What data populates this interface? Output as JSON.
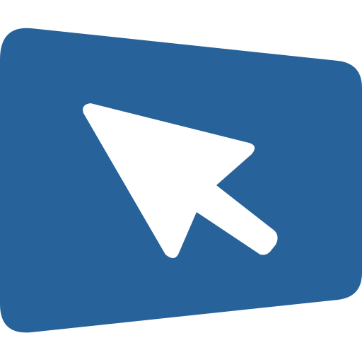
{
  "icon": {
    "name": "cursor-in-screen-icon",
    "description_for_agents": "",
    "colors": {
      "background": "#ffffff",
      "panel": "#27629A",
      "cursor": "#ffffff"
    }
  }
}
